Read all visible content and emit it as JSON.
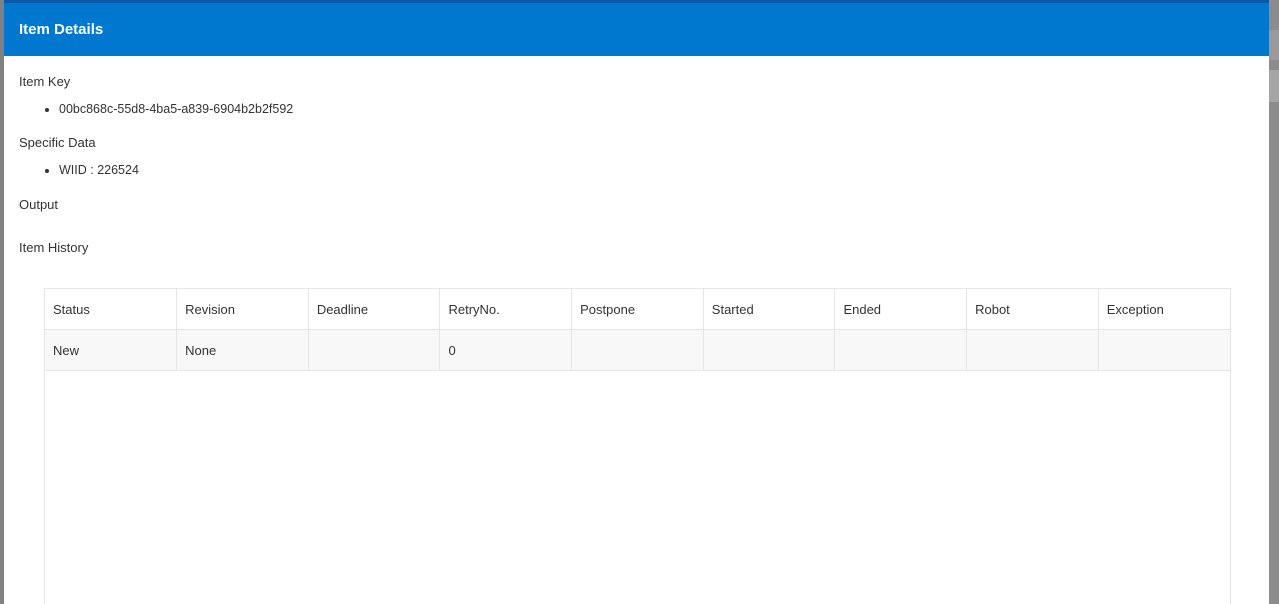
{
  "dialog": {
    "title": "Item Details"
  },
  "item_key": {
    "label": "Item Key",
    "values": [
      "00bc868c-55d8-4ba5-a839-6904b2b2f592"
    ]
  },
  "specific_data": {
    "label": "Specific Data",
    "values": [
      "WIID : 226524"
    ]
  },
  "output": {
    "label": "Output"
  },
  "history": {
    "label": "Item History",
    "columns": [
      "Status",
      "Revision",
      "Deadline",
      "RetryNo.",
      "Postpone",
      "Started",
      "Ended",
      "Robot",
      "Exception"
    ],
    "rows": [
      [
        "New",
        "None",
        "",
        "0",
        "",
        "",
        "",
        "",
        ""
      ]
    ]
  }
}
